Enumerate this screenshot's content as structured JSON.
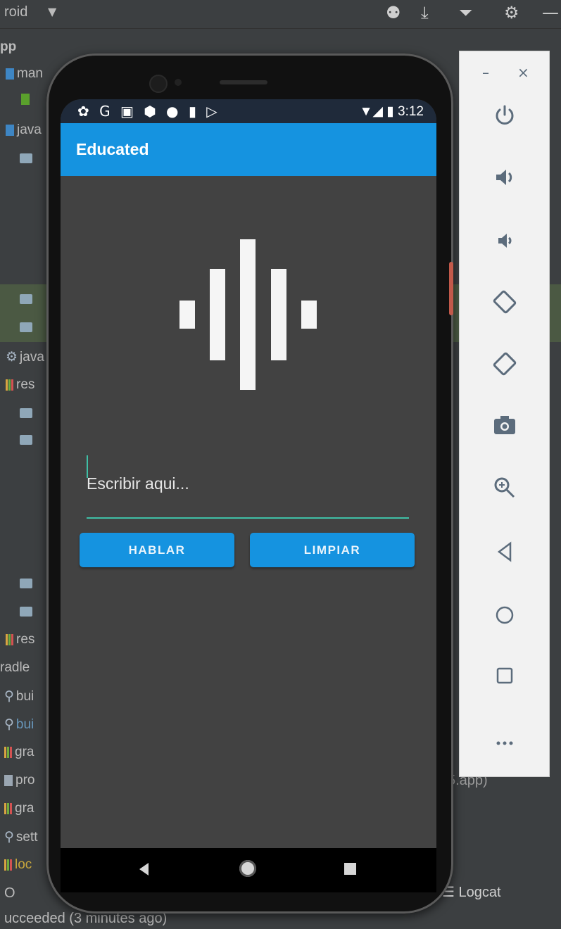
{
  "ide": {
    "toolbar_title": "roid",
    "toolbar_caret": "▼",
    "toolbar_icons": [
      "bug-icon",
      "download-icon",
      "filter-icon",
      "gear-icon",
      "minimize-icon"
    ],
    "tree_items": [
      {
        "label": "pp",
        "icon": "none"
      },
      {
        "label": "man",
        "icon": "module-icon"
      },
      {
        "label": "",
        "icon": "manifest-icon"
      },
      {
        "label": "java",
        "icon": "module-icon"
      },
      {
        "label": "",
        "icon": "folder-icon"
      },
      {
        "label": "",
        "icon": "folder-icon"
      },
      {
        "label": "",
        "icon": "folder-icon"
      },
      {
        "label": "java",
        "icon": "java-icon"
      },
      {
        "label": "res",
        "icon": "res-icon"
      },
      {
        "label": "",
        "icon": "folder-icon"
      },
      {
        "label": "",
        "icon": "folder-icon"
      },
      {
        "label": "",
        "icon": "folder-icon"
      },
      {
        "label": "",
        "icon": "folder-icon"
      },
      {
        "label": "res",
        "icon": "res-icon"
      },
      {
        "label": "radle",
        "icon": "none"
      },
      {
        "label": "bui",
        "icon": "wrench-icon"
      },
      {
        "label": "bui",
        "icon": "wrench-icon"
      },
      {
        "label": "gra",
        "icon": "bars-icon"
      },
      {
        "label": "pro",
        "icon": "doc-icon"
      },
      {
        "label": "gra",
        "icon": "bars-icon"
      },
      {
        "label": "sett",
        "icon": "wrench-icon"
      },
      {
        "label": "loc",
        "icon": "bars-icon"
      }
    ],
    "bottom_left": "O",
    "logcat_label": "Logcat",
    "app_tag": "5.app)",
    "build_status": "ucceeded (3 minutes ago)"
  },
  "phone": {
    "status_icons": "✿ G ▣ ⬢ ● ▮ ▷",
    "status_right": "▼◢ ▮ 3:12",
    "app_title": "Educated",
    "input_placeholder": "Escribir aqui...",
    "hablar_label": "HABLAR",
    "limpiar_label": "LIMPIAR",
    "accent": "#1593e0",
    "underline_color": "#3fbfa6"
  },
  "emulator_panel": {
    "minimize_label": "–",
    "close_label": "×",
    "buttons": [
      {
        "name": "power-button",
        "icon": "power-icon",
        "glyph": "⏻"
      },
      {
        "name": "volume-up-button",
        "icon": "volume-up-icon",
        "glyph": "🔊"
      },
      {
        "name": "volume-down-button",
        "icon": "volume-down-icon",
        "glyph": "🔉"
      },
      {
        "name": "rotate-left-button",
        "icon": "rotate-left-icon",
        "glyph": "◇"
      },
      {
        "name": "rotate-right-button",
        "icon": "rotate-right-icon",
        "glyph": "◇"
      },
      {
        "name": "screenshot-button",
        "icon": "camera-icon",
        "glyph": "📷"
      },
      {
        "name": "zoom-button",
        "icon": "zoom-in-icon",
        "glyph": "🔍"
      },
      {
        "name": "back-button",
        "icon": "back-triangle-icon",
        "glyph": "◁"
      },
      {
        "name": "home-button",
        "icon": "home-circle-icon",
        "glyph": "○"
      },
      {
        "name": "overview-button",
        "icon": "overview-square-icon",
        "glyph": "□"
      },
      {
        "name": "more-button",
        "icon": "more-dots-icon",
        "glyph": "•••"
      }
    ]
  }
}
